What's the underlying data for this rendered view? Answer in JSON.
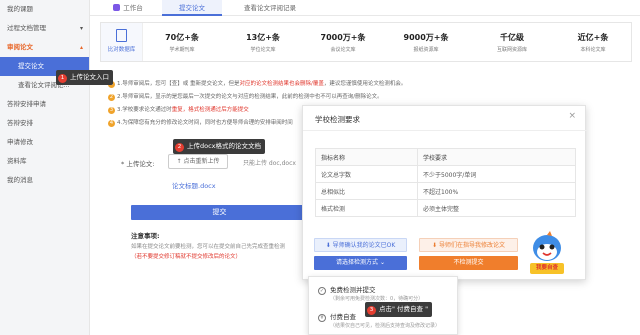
{
  "sidebar": {
    "items": [
      {
        "label": "我的课题"
      },
      {
        "label": "过程文档管理",
        "chev": "▾"
      },
      {
        "label": "审阅论文",
        "chev": "▴"
      },
      {
        "label": "提交论文"
      },
      {
        "label": "查看论文评阅记..."
      },
      {
        "label": "答辩安排申请"
      },
      {
        "label": "答辩安排"
      },
      {
        "label": "申请修改"
      },
      {
        "label": "资料库"
      },
      {
        "label": "我的消息"
      }
    ]
  },
  "topbar": {
    "tabs": [
      {
        "label": "工作台"
      },
      {
        "label": "提交论文"
      },
      {
        "label": "查看论文评阅记录"
      }
    ]
  },
  "stats": {
    "first_label": "比对数据库",
    "items": [
      {
        "value": "70亿+条",
        "label": "学术期刊库"
      },
      {
        "value": "13亿+条",
        "label": "学位论文库"
      },
      {
        "value": "7000万+条",
        "label": "会议论文库"
      },
      {
        "value": "9000万+条",
        "label": "报纸资源库"
      },
      {
        "value": "千亿级",
        "label": "互联网资源库"
      },
      {
        "value": "近亿+条",
        "label": "本科论文库"
      }
    ]
  },
  "notices": [
    {
      "num": "1",
      "pre": "1.导师审阅后，您可【查】或 重新提交论文，但是",
      "red": "对应的论文检测结果也会删除/覆盖",
      "post": "，建议您谨慎使用论文检测机会。"
    },
    {
      "num": "2",
      "pre": "2.导师审阅后，显示的是您最后一次提交的论文与对应的检测结果，此前的检测中也不可以再查询/删除论文。",
      "red": "",
      "post": ""
    },
    {
      "num": "3",
      "pre": "3.学校要求论文通过时",
      "red": "",
      "post": "重复，格式检测通过后方能提交"
    },
    {
      "num": "4",
      "pre": "4.为保障您有充分的修改论文时间，同时也方便导师合理的安排审阅时间",
      "red": "",
      "post": ""
    }
  ],
  "upload": {
    "label": "* 上传论文:",
    "button": "↑ 点击重新上传",
    "hint": "只能上传 doc,docx",
    "file_name": "论文标题.docx",
    "submit_label": "提交"
  },
  "notes": {
    "title": "注意事项:",
    "line1": "如果在提交论文前要检测，您可以在提交前自己先完成查重检测",
    "line2": "（若不要提交修订稿就不提交修改后的论文）"
  },
  "callouts": {
    "step1": {
      "badge": "1",
      "text": "上传论文入口"
    },
    "step2": {
      "badge": "2",
      "text": "上传docx格式的论文文档"
    },
    "step3": {
      "badge": "3",
      "text": "点击\" 付费自查 \""
    }
  },
  "modal": {
    "title": "学校检测要求",
    "close": "×",
    "table": {
      "headers": [
        "指标名称",
        "学校要求"
      ],
      "rows": [
        [
          "论文总字数",
          "不少于5000字/单词"
        ],
        [
          "总相似比",
          "不超过100%"
        ],
        [
          "格式检测",
          "必须主体完整"
        ]
      ]
    },
    "btn_link_self": "⬇ 导师确认我的论文已OK",
    "btn_link_guide": "⬇ 导师们在指导我修改论文",
    "btn_choose": "请选择检测方式 ⌄",
    "btn_skip": "不检测提交",
    "mascot_label": "我要自查"
  },
  "dropdown": {
    "items": [
      {
        "icon": "✓",
        "title": "免费检测并提交",
        "sub": "（剩余可用免费检测次数：0，待确可分）"
      },
      {
        "icon": "¥",
        "title": "付费自查",
        "sub": "（结果仅自己可见，检测后支持查询及修改记录）"
      }
    ]
  },
  "colors": {
    "primary": "#4a6fd8",
    "orange": "#f07e2c",
    "red": "#e0352b",
    "callout_bg": "#3b3b3b"
  }
}
